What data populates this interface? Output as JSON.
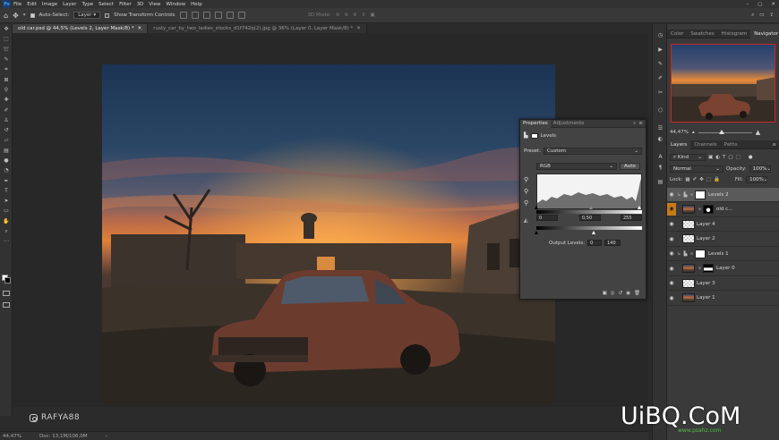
{
  "menu": {
    "logo": "Ps",
    "items": [
      "File",
      "Edit",
      "Image",
      "Layer",
      "Type",
      "Select",
      "Filter",
      "3D",
      "View",
      "Window",
      "Help"
    ]
  },
  "options_bar": {
    "auto_select_label": "Auto-Select:",
    "auto_select_value": "Layer",
    "show_transform_label": "Show Transform Controls",
    "mode_3d_label": "3D Mode:"
  },
  "tabs": [
    {
      "label": "old car.psd @ 44,5% (Levels 2, Layer Mask/8) *",
      "active": true
    },
    {
      "label": "rusty_car_by_two_ladies_stocks_d1f742q(2).jpg @ 36% (Layer 0, Layer Mask/8) *",
      "active": false
    }
  ],
  "status": {
    "zoom": "44,47%",
    "doc": "Doc: 13,1M/106,0M"
  },
  "properties": {
    "tabs": [
      "Properties",
      "Adjustments"
    ],
    "adjustment_name": "Levels",
    "preset_label": "Preset:",
    "preset_value": "Custom",
    "channel_value": "RGB",
    "auto_label": "Auto",
    "input_black": "0",
    "input_gamma": "0,50",
    "input_white": "255",
    "output_label": "Output Levels:",
    "output_black": "0",
    "output_white": "140",
    "input_gamma_pos": 0.52,
    "output_white_pos": 0.55
  },
  "panel_top": {
    "tabs": [
      "Color",
      "Swatches",
      "Histogram",
      "Navigator"
    ],
    "zoom": "44,47%"
  },
  "layers_panel": {
    "tabs": [
      "Layers",
      "Channels",
      "Paths"
    ],
    "kind_label": "Kind",
    "blend_mode": "Normal",
    "opacity_label": "Opacity:",
    "opacity_value": "100%",
    "lock_label": "Lock:",
    "fill_label": "Fill:",
    "fill_value": "100%",
    "layers": [
      {
        "name": "Levels 2",
        "type": "adjustment",
        "selected": true,
        "visible": true,
        "thumb": "white"
      },
      {
        "name": "old c...",
        "type": "image",
        "selected": false,
        "visible": true,
        "thumb": "img",
        "mask": "black"
      },
      {
        "name": "Layer 4",
        "type": "pixel",
        "selected": false,
        "visible": true,
        "thumb": "checker"
      },
      {
        "name": "Layer 2",
        "type": "pixel",
        "selected": false,
        "visible": true,
        "thumb": "checker"
      },
      {
        "name": "Levels 1",
        "type": "adjustment",
        "selected": false,
        "visible": true,
        "thumb": "white"
      },
      {
        "name": "Layer 0",
        "type": "image",
        "selected": false,
        "visible": true,
        "thumb": "img",
        "mask": "black"
      },
      {
        "name": "Layer 3",
        "type": "pixel",
        "selected": false,
        "visible": true,
        "thumb": "checker"
      },
      {
        "name": "Layer 1",
        "type": "pixel",
        "selected": false,
        "visible": true,
        "thumb": "img"
      }
    ]
  },
  "watermarks": {
    "instagram": "RAFYA88",
    "brand": "UiBQ.CoM",
    "brand_sub": "www.psahz.com"
  },
  "colors": {
    "accent": "#31a8ff",
    "selection_border": "#c62828",
    "highlight": "#eedc3c"
  }
}
